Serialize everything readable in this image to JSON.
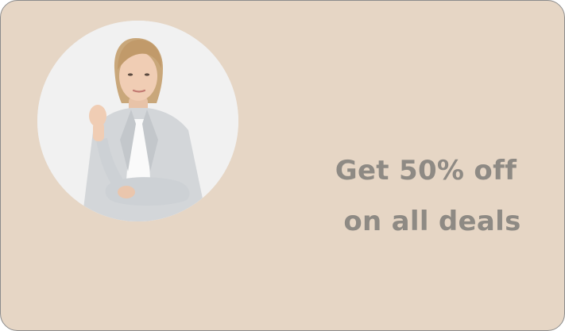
{
  "promo": {
    "line1": "Get 50% off",
    "line2": "on all deals"
  },
  "colors": {
    "card_background": "#e6d6c5",
    "card_border": "#8c8c8c",
    "promo_text": "#8e8a84",
    "photo_background": "#efefef"
  },
  "image": {
    "subject": "woman-in-light-grey-blazer"
  }
}
